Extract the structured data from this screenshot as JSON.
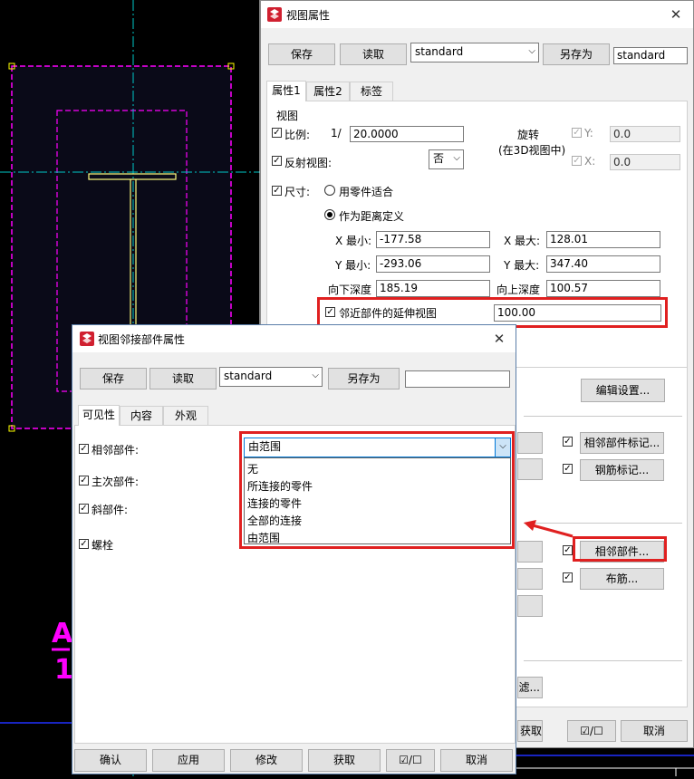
{
  "cad": {
    "label_letter": "A",
    "label_number": "1"
  },
  "view_props": {
    "title": "视图属性",
    "toolbar": {
      "save": "保存",
      "load": "读取",
      "preset": "standard",
      "save_as": "另存为",
      "save_as_name": "standard"
    },
    "tabs": [
      "属性1",
      "属性2",
      "标签"
    ],
    "view_group": "视图",
    "scale_label": "比例:",
    "scale_prefix": "1/",
    "scale_value": "20.0000",
    "rotation_label": "旋转",
    "rotation_sub": "(在3D视图中)",
    "rot_y_label": "Y:",
    "rot_y_value": "0.0",
    "rot_x_label": "X:",
    "rot_x_value": "0.0",
    "mirror_label": "反射视图:",
    "mirror_value": "否",
    "size_label": "尺寸:",
    "radio_fit": "用零件适合",
    "radio_dist": "作为距离定义",
    "x_min_label": "X 最小:",
    "x_min": "-177.58",
    "x_max_label": "X 最大:",
    "x_max": "128.01",
    "y_min_label": "Y 最小:",
    "y_min": "-293.06",
    "y_max_label": "Y 最大:",
    "y_max": "347.40",
    "depth_down_label": "向下深度",
    "depth_down": "185.19",
    "depth_up_label": "向上深度",
    "depth_up": "100.57",
    "neighbor_ext_label": "邻近部件的延伸视图",
    "neighbor_ext_value": "100.00",
    "edit_settings": "编辑设置...",
    "neighbor_mark": "相邻部件标记...",
    "rebar_mark": "钢筋标记...",
    "neighbor_parts": "相邻部件...",
    "rebar": "布筋...",
    "filter_partial": "滤...",
    "bottom": {
      "get_partial": "获取",
      "cancel": "取消"
    }
  },
  "neighbor_dlg": {
    "title": "视图邻接部件属性",
    "toolbar": {
      "save": "保存",
      "load": "读取",
      "preset": "standard",
      "save_as": "另存为",
      "save_as_name": ""
    },
    "tabs": [
      "可见性",
      "内容",
      "外观"
    ],
    "rows": [
      {
        "label": "相邻部件:"
      },
      {
        "label": "主次部件:"
      },
      {
        "label": "斜部件:"
      },
      {
        "label": "螺栓"
      }
    ],
    "dropdown": {
      "selected": "由范围",
      "options": [
        "无",
        "所连接的零件",
        "连接的零件",
        "全部的连接",
        "由范围"
      ]
    },
    "footer": {
      "ok": "确认",
      "apply": "应用",
      "modify": "修改",
      "get": "获取",
      "cancel": "取消"
    }
  },
  "colors": {
    "accent_red": "#e02020",
    "cad_magenta": "#ff00ff",
    "cad_cyan": "#00c8c8",
    "cad_yellow": "#ffff80",
    "dropdown_highlight": "#0078d7"
  }
}
